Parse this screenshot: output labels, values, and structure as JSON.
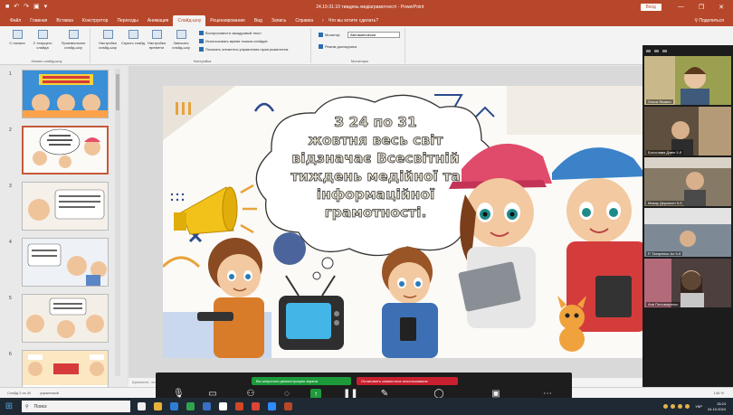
{
  "titlebar": {
    "doc_title": "24.10-31.10 тиждень медіаграмотності - PowerPoint",
    "user_btn": "Вход",
    "minimize": "—",
    "restore": "❐",
    "close": "✕"
  },
  "ribbon": {
    "tabs": [
      "Файл",
      "Главная",
      "Вставка",
      "Конструктор",
      "Переходы",
      "Анимация",
      "Слайд-шоу",
      "Рецензирование",
      "Вид",
      "Запись",
      "Справка"
    ],
    "active_tab": "Слайд-шоу",
    "tell_me": "Что вы хотите сделать?",
    "share": "Поделиться",
    "group_start": {
      "label": "Начать слайд-шоу",
      "buttons": [
        "С начала",
        "С текущего слайда",
        "Произвольное слайд-шоу"
      ]
    },
    "group_setup": {
      "label": "Настройка",
      "buttons": [
        "Настройка слайд-шоу",
        "Скрыть слайд",
        "Настройка времени",
        "Записать слайд-шоу"
      ],
      "checkboxes": [
        "Воспроизвести закадровый текст",
        "Использовать время показа слайдов",
        "Показать элементы управления проигрывателем"
      ]
    },
    "group_monitors": {
      "label": "Мониторы",
      "monitor_label": "Монитор:",
      "monitor_value": "Автоматически",
      "presenter_view": "Режим докладчика"
    }
  },
  "thumbnails": {
    "numbers": [
      "1",
      "2",
      "3",
      "4",
      "5",
      "6"
    ],
    "selected_index": 2
  },
  "slide": {
    "heading_lines": [
      "З 24 по 31",
      "жовтня весь світ",
      "відзначає Всесвітній",
      "тиждень медійної та",
      "інформаційної",
      "грамотності."
    ]
  },
  "notes": {
    "placeholder": "Щелкните, чтобы добавить заметки"
  },
  "video_participants": [
    {
      "name": "Ольга Якович"
    },
    {
      "name": "Богослава Дзвін 5-б"
    },
    {
      "name": "Макар Деркачен 5-б"
    },
    {
      "name": "Р. Татаренко Ал 5-б"
    },
    {
      "name": "Аня Пономаренко"
    }
  ],
  "statusbar": {
    "slide_info": "Слайд 2 из 40",
    "language": "украинский",
    "zoom": "146 %"
  },
  "zoom_toolbar": {
    "sharing_label": "Вы запустили демонстрацию экрана",
    "stop_label": "Остановить совместное использование",
    "items": [
      "Звук",
      "Видео",
      "Участники",
      "Чат",
      "Поделиться",
      "Пауза",
      "Комментировать",
      "Дистанционное управление",
      "Показать конференцию",
      "Дополнительно"
    ]
  },
  "taskbar": {
    "search_placeholder": "Поиск",
    "lang": "УКР",
    "time": "15:24",
    "date": "24.10.2024"
  }
}
